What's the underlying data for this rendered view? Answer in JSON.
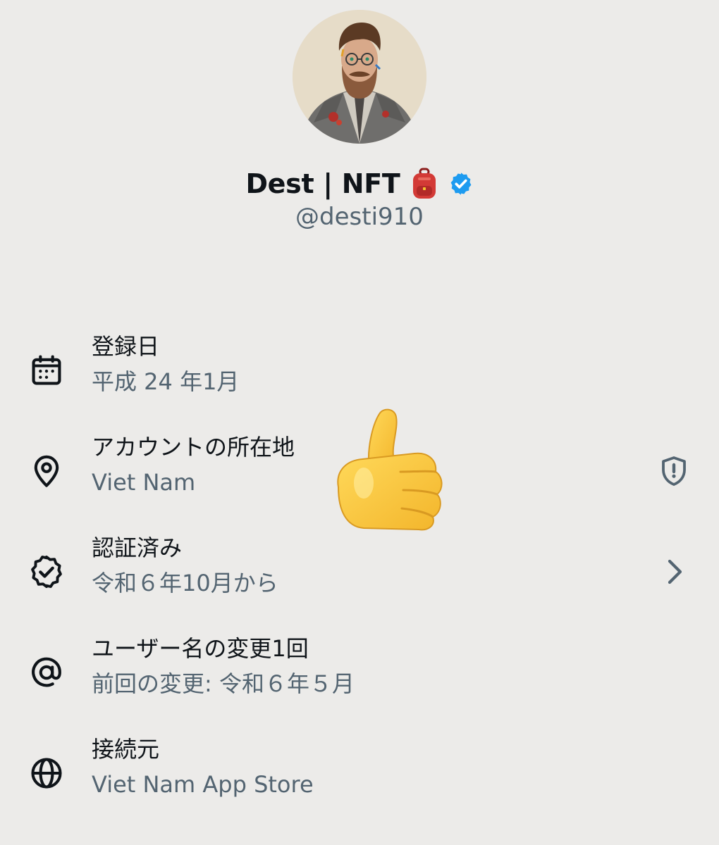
{
  "profile": {
    "display_name": "Dest | NFT",
    "handle": "@desti910",
    "avatar_icon": "bearded-man-in-suit-avatar",
    "name_emoji": "backpack-emoji",
    "verified_icon": "verified-badge-icon",
    "verified_color": "#1d9bf0"
  },
  "rows": [
    {
      "icon": "calendar-icon",
      "title": "登録日",
      "subtitle": "平成 24 年1月"
    },
    {
      "icon": "location-pin-icon",
      "title": "アカウントの所在地",
      "subtitle": "Viet Nam",
      "trailing_icon": "shield-alert-icon"
    },
    {
      "icon": "verified-outline-icon",
      "title": "認証済み",
      "subtitle": "令和６年10月から",
      "trailing_icon": "chevron-right-icon"
    },
    {
      "icon": "at-sign-icon",
      "title": "ユーザー名の変更1回",
      "subtitle": "前回の変更: 令和６年５月"
    },
    {
      "icon": "globe-icon",
      "title": "接続元",
      "subtitle": "Viet Nam App Store"
    }
  ],
  "overlay": {
    "emoji": "thumbs-up-emoji"
  },
  "colors": {
    "background": "#ecebe9",
    "primary_text": "#0f1419",
    "secondary_text": "#536471",
    "accent": "#1d9bf0"
  }
}
